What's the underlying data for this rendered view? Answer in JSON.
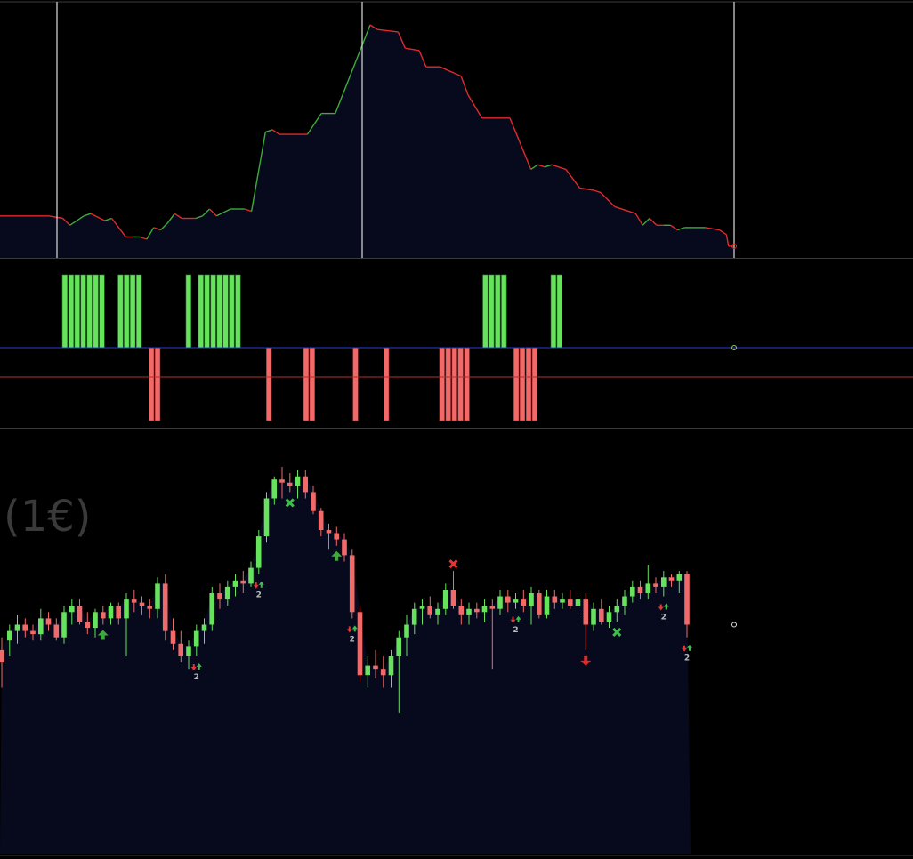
{
  "colors": {
    "background": "#000000",
    "area_fill": "#060a1c",
    "up": "#66e25c",
    "down": "#f06a6a",
    "line_up": "#3daa3d",
    "line_down": "#e02a2a",
    "separator": "#3a3a3a",
    "vline": "#dddddd",
    "zero_line": "#2c3ad6",
    "ref_line": "#b03030",
    "marker_count": "#bbbbbb",
    "watermark": "#3a3a3a"
  },
  "watermark": {
    "text": "(1€)"
  },
  "chart_data": [
    {
      "name": "equity-line",
      "type": "area",
      "x_count": 90,
      "ylim": [
        0,
        100
      ],
      "vertical_markers": [
        7,
        46,
        93
      ],
      "points": [
        [
          0,
          18
        ],
        [
          7,
          18
        ],
        [
          9,
          17
        ],
        [
          10,
          14
        ],
        [
          12,
          18
        ],
        [
          13,
          19
        ],
        [
          15,
          16
        ],
        [
          16,
          17
        ],
        [
          18,
          9
        ],
        [
          19,
          9
        ],
        [
          20,
          9
        ],
        [
          21,
          8
        ],
        [
          22,
          13
        ],
        [
          23,
          12
        ],
        [
          24,
          15
        ],
        [
          25,
          19
        ],
        [
          26,
          17
        ],
        [
          28,
          17
        ],
        [
          29,
          18
        ],
        [
          30,
          21
        ],
        [
          31,
          18
        ],
        [
          33,
          21
        ],
        [
          35,
          21
        ],
        [
          36,
          20
        ],
        [
          38,
          54
        ],
        [
          39,
          55
        ],
        [
          40,
          53
        ],
        [
          44,
          53
        ],
        [
          46,
          62
        ],
        [
          48,
          62
        ],
        [
          53,
          100
        ],
        [
          54,
          98
        ],
        [
          57,
          97
        ],
        [
          58,
          90
        ],
        [
          60,
          89
        ],
        [
          61,
          82
        ],
        [
          63,
          82
        ],
        [
          66,
          78
        ],
        [
          67,
          70
        ],
        [
          69,
          60
        ],
        [
          73,
          60
        ],
        [
          76,
          38
        ],
        [
          77,
          40
        ],
        [
          78,
          39
        ],
        [
          79,
          40
        ],
        [
          81,
          38
        ],
        [
          83,
          30
        ],
        [
          85,
          29
        ],
        [
          86,
          28
        ],
        [
          88,
          22
        ],
        [
          90,
          20
        ],
        [
          91,
          19
        ],
        [
          92,
          14
        ],
        [
          93,
          17
        ],
        [
          94,
          14
        ],
        [
          95,
          14
        ],
        [
          96,
          14
        ],
        [
          97,
          12
        ],
        [
          98,
          13
        ],
        [
          100,
          13
        ],
        [
          101,
          13
        ],
        [
          103,
          12
        ],
        [
          104,
          10
        ],
        [
          104.3,
          5
        ],
        [
          105,
          5
        ]
      ],
      "color_up": "#3daa3d",
      "color_down": "#e02a2a"
    },
    {
      "name": "signal-bars",
      "type": "bar",
      "x_count": 90,
      "ylim": [
        -1,
        1
      ],
      "positive_bars": [
        8,
        9,
        10,
        11,
        12,
        13,
        14,
        17,
        18,
        19,
        20,
        28,
        30,
        31,
        32,
        33,
        34,
        35,
        36,
        76,
        77,
        78,
        79,
        87,
        88
      ],
      "negative_bars": [
        22,
        23,
        41,
        47,
        48,
        55,
        60,
        69,
        70,
        71,
        72,
        73,
        81,
        82,
        83,
        84
      ],
      "reference_level": -0.4
    },
    {
      "name": "price-candles",
      "type": "candlestick",
      "x_count": 95,
      "ylim": [
        0,
        100
      ],
      "candles": [
        {
          "o": 42,
          "h": 46,
          "l": 30,
          "c": 38
        },
        {
          "o": 45,
          "h": 50,
          "l": 40,
          "c": 48
        },
        {
          "o": 48,
          "h": 53,
          "l": 44,
          "c": 50
        },
        {
          "o": 50,
          "h": 52,
          "l": 46,
          "c": 48
        },
        {
          "o": 48,
          "h": 50,
          "l": 45,
          "c": 47
        },
        {
          "o": 47,
          "h": 55,
          "l": 45,
          "c": 52
        },
        {
          "o": 52,
          "h": 54,
          "l": 48,
          "c": 50
        },
        {
          "o": 50,
          "h": 52,
          "l": 45,
          "c": 46
        },
        {
          "o": 46,
          "h": 56,
          "l": 44,
          "c": 54
        },
        {
          "o": 54,
          "h": 58,
          "l": 50,
          "c": 56
        },
        {
          "o": 56,
          "h": 58,
          "l": 50,
          "c": 51
        },
        {
          "o": 51,
          "h": 54,
          "l": 47,
          "c": 49
        },
        {
          "o": 49,
          "h": 55,
          "l": 46,
          "c": 54
        },
        {
          "o": 54,
          "h": 56,
          "l": 50,
          "c": 52
        },
        {
          "o": 52,
          "h": 57,
          "l": 50,
          "c": 56
        },
        {
          "o": 56,
          "h": 57,
          "l": 50,
          "c": 52
        },
        {
          "o": 52,
          "h": 60,
          "l": 40,
          "c": 58
        },
        {
          "o": 58,
          "h": 61,
          "l": 54,
          "c": 57
        },
        {
          "o": 57,
          "h": 59,
          "l": 53,
          "c": 56
        },
        {
          "o": 56,
          "h": 58,
          "l": 52,
          "c": 55
        },
        {
          "o": 55,
          "h": 65,
          "l": 52,
          "c": 63
        },
        {
          "o": 63,
          "h": 66,
          "l": 45,
          "c": 48
        },
        {
          "o": 48,
          "h": 52,
          "l": 42,
          "c": 44
        },
        {
          "o": 44,
          "h": 48,
          "l": 38,
          "c": 40
        },
        {
          "o": 40,
          "h": 45,
          "l": 36,
          "c": 43
        },
        {
          "o": 43,
          "h": 50,
          "l": 40,
          "c": 48
        },
        {
          "o": 48,
          "h": 52,
          "l": 44,
          "c": 50
        },
        {
          "o": 50,
          "h": 62,
          "l": 48,
          "c": 60
        },
        {
          "o": 60,
          "h": 63,
          "l": 55,
          "c": 58
        },
        {
          "o": 58,
          "h": 64,
          "l": 56,
          "c": 62
        },
        {
          "o": 62,
          "h": 66,
          "l": 59,
          "c": 64
        },
        {
          "o": 64,
          "h": 67,
          "l": 60,
          "c": 63
        },
        {
          "o": 63,
          "h": 70,
          "l": 62,
          "c": 68
        },
        {
          "o": 68,
          "h": 80,
          "l": 66,
          "c": 78
        },
        {
          "o": 78,
          "h": 92,
          "l": 76,
          "c": 90
        },
        {
          "o": 90,
          "h": 97,
          "l": 88,
          "c": 96
        },
        {
          "o": 96,
          "h": 100,
          "l": 90,
          "c": 95
        },
        {
          "o": 95,
          "h": 98,
          "l": 92,
          "c": 94
        },
        {
          "o": 94,
          "h": 99,
          "l": 90,
          "c": 97
        },
        {
          "o": 97,
          "h": 99,
          "l": 90,
          "c": 92
        },
        {
          "o": 92,
          "h": 94,
          "l": 85,
          "c": 86
        },
        {
          "o": 86,
          "h": 87,
          "l": 78,
          "c": 80
        },
        {
          "o": 80,
          "h": 82,
          "l": 74,
          "c": 79
        },
        {
          "o": 79,
          "h": 81,
          "l": 75,
          "c": 77
        },
        {
          "o": 77,
          "h": 79,
          "l": 70,
          "c": 72
        },
        {
          "o": 72,
          "h": 74,
          "l": 52,
          "c": 54
        },
        {
          "o": 54,
          "h": 56,
          "l": 32,
          "c": 34
        },
        {
          "o": 34,
          "h": 40,
          "l": 30,
          "c": 37
        },
        {
          "o": 37,
          "h": 42,
          "l": 33,
          "c": 36
        },
        {
          "o": 36,
          "h": 40,
          "l": 30,
          "c": 34
        },
        {
          "o": 34,
          "h": 42,
          "l": 30,
          "c": 40
        },
        {
          "o": 40,
          "h": 48,
          "l": 22,
          "c": 46
        },
        {
          "o": 46,
          "h": 53,
          "l": 40,
          "c": 50
        },
        {
          "o": 50,
          "h": 57,
          "l": 47,
          "c": 55
        },
        {
          "o": 55,
          "h": 58,
          "l": 50,
          "c": 56
        },
        {
          "o": 56,
          "h": 59,
          "l": 52,
          "c": 53
        },
        {
          "o": 53,
          "h": 57,
          "l": 50,
          "c": 55
        },
        {
          "o": 55,
          "h": 63,
          "l": 53,
          "c": 61
        },
        {
          "o": 61,
          "h": 67,
          "l": 55,
          "c": 56
        },
        {
          "o": 56,
          "h": 58,
          "l": 50,
          "c": 53
        },
        {
          "o": 53,
          "h": 57,
          "l": 50,
          "c": 55
        },
        {
          "o": 55,
          "h": 57,
          "l": 52,
          "c": 54
        },
        {
          "o": 54,
          "h": 58,
          "l": 51,
          "c": 56
        },
        {
          "o": 56,
          "h": 58,
          "l": 36,
          "c": 55
        },
        {
          "o": 55,
          "h": 61,
          "l": 53,
          "c": 59
        },
        {
          "o": 59,
          "h": 61,
          "l": 54,
          "c": 57
        },
        {
          "o": 57,
          "h": 60,
          "l": 55,
          "c": 58
        },
        {
          "o": 58,
          "h": 61,
          "l": 54,
          "c": 56
        },
        {
          "o": 56,
          "h": 62,
          "l": 50,
          "c": 60
        },
        {
          "o": 60,
          "h": 61,
          "l": 52,
          "c": 53
        },
        {
          "o": 53,
          "h": 61,
          "l": 52,
          "c": 59
        },
        {
          "o": 59,
          "h": 61,
          "l": 55,
          "c": 57
        },
        {
          "o": 57,
          "h": 60,
          "l": 55,
          "c": 58
        },
        {
          "o": 58,
          "h": 61,
          "l": 55,
          "c": 56
        },
        {
          "o": 56,
          "h": 60,
          "l": 53,
          "c": 58
        },
        {
          "o": 58,
          "h": 60,
          "l": 42,
          "c": 50
        },
        {
          "o": 50,
          "h": 57,
          "l": 48,
          "c": 55
        },
        {
          "o": 55,
          "h": 58,
          "l": 50,
          "c": 51
        },
        {
          "o": 51,
          "h": 56,
          "l": 49,
          "c": 54
        },
        {
          "o": 54,
          "h": 58,
          "l": 51,
          "c": 56
        },
        {
          "o": 56,
          "h": 61,
          "l": 53,
          "c": 59
        },
        {
          "o": 59,
          "h": 64,
          "l": 57,
          "c": 62
        },
        {
          "o": 62,
          "h": 64,
          "l": 58,
          "c": 60
        },
        {
          "o": 60,
          "h": 69,
          "l": 58,
          "c": 63
        },
        {
          "o": 63,
          "h": 65,
          "l": 60,
          "c": 62
        },
        {
          "o": 62,
          "h": 67,
          "l": 59,
          "c": 65
        },
        {
          "o": 65,
          "h": 66,
          "l": 62,
          "c": 64
        },
        {
          "o": 64,
          "h": 67,
          "l": 60,
          "c": 66
        },
        {
          "o": 66,
          "h": 67,
          "l": 46,
          "c": 50
        }
      ],
      "markers": [
        {
          "i": 13,
          "kind": "arrow-up",
          "pos": "below"
        },
        {
          "i": 25,
          "kind": "down-up",
          "pos": "below",
          "count": "2"
        },
        {
          "i": 33,
          "kind": "down-up",
          "pos": "below",
          "count": "2"
        },
        {
          "i": 37,
          "kind": "cross-green",
          "pos": "below"
        },
        {
          "i": 43,
          "kind": "arrow-up",
          "pos": "below"
        },
        {
          "i": 45,
          "kind": "down-up",
          "pos": "below",
          "count": "2"
        },
        {
          "i": 58,
          "kind": "cross-red",
          "pos": "above"
        },
        {
          "i": 66,
          "kind": "down-up",
          "pos": "below",
          "count": "2"
        },
        {
          "i": 75,
          "kind": "arrow-down",
          "pos": "below"
        },
        {
          "i": 79,
          "kind": "cross-green",
          "pos": "below"
        },
        {
          "i": 85,
          "kind": "down-up",
          "pos": "below",
          "count": "2"
        },
        {
          "i": 88,
          "kind": "down-up",
          "pos": "below",
          "count": "2"
        }
      ]
    }
  ]
}
